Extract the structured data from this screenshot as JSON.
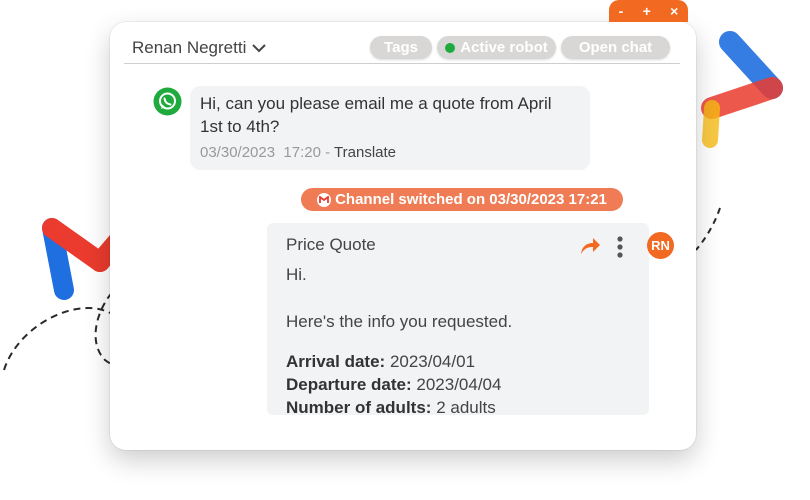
{
  "window_controls": {
    "minimize": "-",
    "maximize": "+",
    "close": "×"
  },
  "header": {
    "contact_name": "Renan Negretti",
    "tags_label": "Tags",
    "robot_label": "Active robot",
    "open_chat_label": "Open chat"
  },
  "incoming_message": {
    "text": "Hi, can you please email me a quote from April 1st to 4th?",
    "date": "03/30/2023",
    "time": "17:20",
    "separator": "-",
    "translate_label": "Translate"
  },
  "channel_switch": {
    "text": "Channel switched on 03/30/2023 17:21"
  },
  "email": {
    "subject": "Price Quote",
    "greeting": "Hi.",
    "intro": "Here's the info you requested.",
    "fields": [
      {
        "label": "Arrival date:",
        "value": "2023/04/01"
      },
      {
        "label": "Departure date:",
        "value": "2023/04/04"
      },
      {
        "label": "Number of adults:",
        "value": "2 adults"
      }
    ],
    "avatar_initials": "RN"
  },
  "colors": {
    "accent": "#f26a21",
    "badge": "#ef7c55",
    "whatsapp": "#1faa3e",
    "robot_dot": "#1faa3e",
    "bubble": "#f2f3f5",
    "pill": "#d9d6d6"
  },
  "icons": [
    "whatsapp-icon",
    "gmail-icon",
    "forward-icon",
    "more-vertical-icon",
    "chevron-down-icon"
  ]
}
